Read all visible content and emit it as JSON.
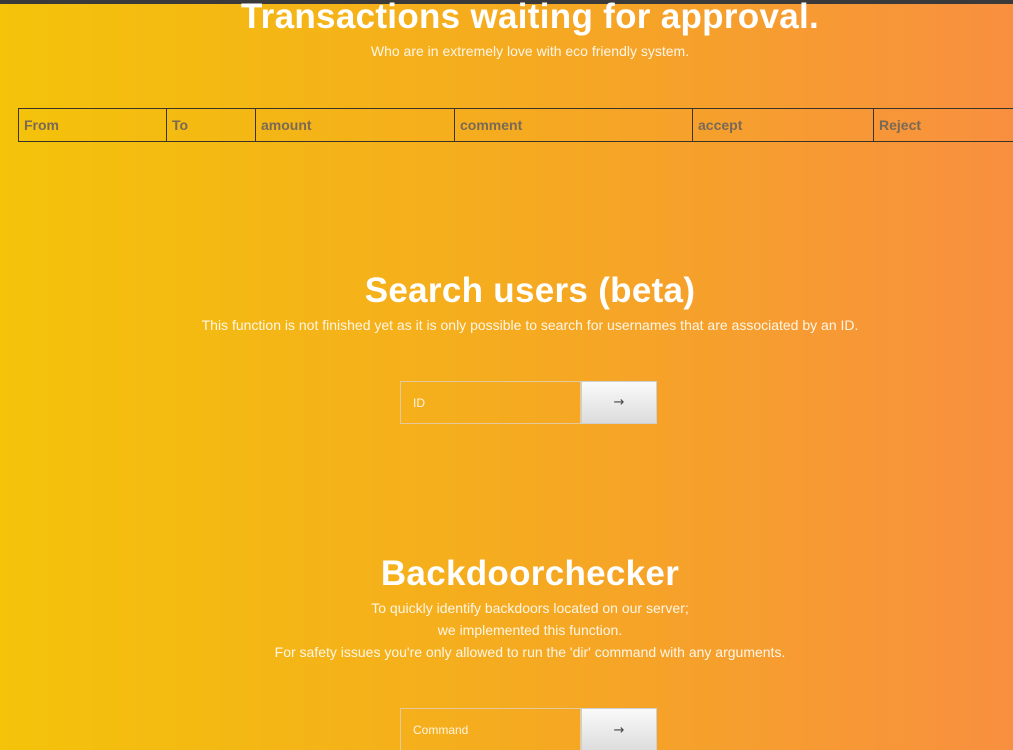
{
  "transactions": {
    "title": "Transactions waiting for approval.",
    "subtitle": "Who are in extremely love with eco friendly system.",
    "columns": [
      "From",
      "To",
      "amount",
      "comment",
      "accept",
      "Reject"
    ]
  },
  "search": {
    "title": "Search users (beta)",
    "description": "This function is not finished yet as it is only possible to search for usernames that are associated by an ID.",
    "input_placeholder": "ID",
    "submit_icon": "arrow-right-icon",
    "submit_glyph": "→"
  },
  "backdoor": {
    "title": "Backdoorchecker",
    "lines": [
      "To quickly identify backdoors located on our server;",
      "we implemented this function.",
      "For safety issues you're only allowed to run the 'dir' command with any arguments."
    ],
    "input_placeholder": "Command",
    "submit_icon": "arrow-right-icon",
    "submit_glyph": "→"
  },
  "colors": {
    "gradient_start": "#f4c30a",
    "gradient_end": "#f88f40",
    "top_bar": "#3a3a3a"
  }
}
